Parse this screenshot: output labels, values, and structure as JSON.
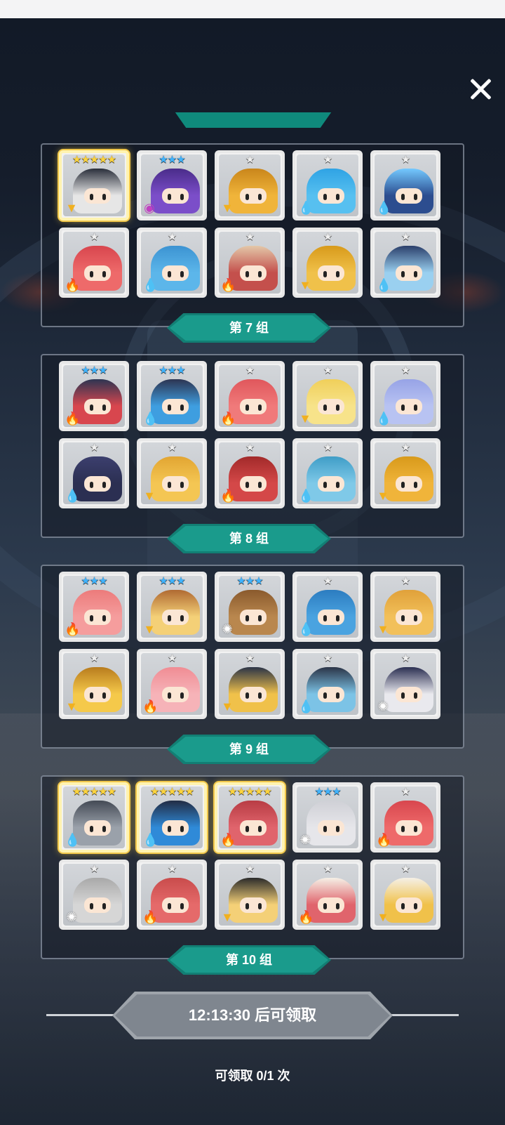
{
  "close": {
    "icon": "close-icon"
  },
  "groups": [
    {
      "label": "第 7 组",
      "heroes": [
        {
          "stars": "★★★★★",
          "rarity": "gold",
          "element": "earth",
          "color": "#e6e6e6",
          "hair": "#2a2f3b"
        },
        {
          "stars": "★★★",
          "rarity": "blue",
          "element": "dark",
          "color": "#7b4ec9",
          "hair": "#4a2c8a"
        },
        {
          "stars": "★",
          "rarity": "grey",
          "element": "earth",
          "color": "#f0b43a",
          "hair": "#c9861b"
        },
        {
          "stars": "★",
          "rarity": "grey",
          "element": "water",
          "color": "#57c0f0",
          "hair": "#2fa3e4"
        },
        {
          "stars": "★",
          "rarity": "grey",
          "element": "water",
          "color": "#2c4d8f",
          "hair": "#74c9ff"
        },
        {
          "stars": "★",
          "rarity": "grey",
          "element": "fire",
          "color": "#ee6a6a",
          "hair": "#d8464e"
        },
        {
          "stars": "★",
          "rarity": "grey",
          "element": "water",
          "color": "#5cb6ea",
          "hair": "#3c93d2"
        },
        {
          "stars": "★",
          "rarity": "grey",
          "element": "fire",
          "color": "#c4504c",
          "hair": "#e3c7a8"
        },
        {
          "stars": "★",
          "rarity": "grey",
          "element": "earth",
          "color": "#f0c14a",
          "hair": "#d89a1b"
        },
        {
          "stars": "★",
          "rarity": "grey",
          "element": "water",
          "color": "#9ad0f0",
          "hair": "#2b3f6b"
        }
      ]
    },
    {
      "label": "第 8 组",
      "heroes": [
        {
          "stars": "★★★",
          "rarity": "blue",
          "element": "fire",
          "color": "#d8464e",
          "hair": "#2d3552"
        },
        {
          "stars": "★★★",
          "rarity": "blue",
          "element": "water",
          "color": "#3e9ee0",
          "hair": "#2d3552"
        },
        {
          "stars": "★",
          "rarity": "grey",
          "element": "fire",
          "color": "#f07a7a",
          "hair": "#e0575c"
        },
        {
          "stars": "★",
          "rarity": "grey",
          "element": "earth",
          "color": "#f7e38a",
          "hair": "#f0cf5a"
        },
        {
          "stars": "★",
          "rarity": "grey",
          "element": "water",
          "color": "#b8c3f2",
          "hair": "#97a3e6"
        },
        {
          "stars": "★",
          "rarity": "grey",
          "element": "water",
          "color": "#2b2f52",
          "hair": "#3c3f6e"
        },
        {
          "stars": "★",
          "rarity": "grey",
          "element": "earth",
          "color": "#f4c653",
          "hair": "#e2a532"
        },
        {
          "stars": "★",
          "rarity": "grey",
          "element": "fire",
          "color": "#d44848",
          "hair": "#a22a2a"
        },
        {
          "stars": "★",
          "rarity": "grey",
          "element": "water",
          "color": "#7fc9e8",
          "hair": "#3f9dc7"
        },
        {
          "stars": "★",
          "rarity": "grey",
          "element": "earth",
          "color": "#f0b43a",
          "hair": "#d89a1b"
        }
      ]
    },
    {
      "label": "第 9 组",
      "heroes": [
        {
          "stars": "★★★",
          "rarity": "blue",
          "element": "fire",
          "color": "#f59d9d",
          "hair": "#ec7b7b"
        },
        {
          "stars": "★★★",
          "rarity": "blue",
          "element": "earth",
          "color": "#f4d077",
          "hair": "#b06a32"
        },
        {
          "stars": "★★★",
          "rarity": "blue",
          "element": "light",
          "color": "#b9874e",
          "hair": "#8a5a2d"
        },
        {
          "stars": "★",
          "rarity": "grey",
          "element": "water",
          "color": "#4aa3e0",
          "hair": "#2c7cc0"
        },
        {
          "stars": "★",
          "rarity": "grey",
          "element": "earth",
          "color": "#f2c05a",
          "hair": "#e0a13a"
        },
        {
          "stars": "★",
          "rarity": "grey",
          "element": "earth",
          "color": "#f5c94a",
          "hair": "#b87c1e"
        },
        {
          "stars": "★",
          "rarity": "grey",
          "element": "fire",
          "color": "#f6b3b8",
          "hair": "#f08c94"
        },
        {
          "stars": "★",
          "rarity": "grey",
          "element": "earth",
          "color": "#f0c14a",
          "hair": "#2b3447"
        },
        {
          "stars": "★",
          "rarity": "grey",
          "element": "water",
          "color": "#7cc3e6",
          "hair": "#2b3447"
        },
        {
          "stars": "★",
          "rarity": "grey",
          "element": "light",
          "color": "#e9e9ee",
          "hair": "#2b2f52"
        }
      ]
    },
    {
      "label": "第 10 组",
      "heroes": [
        {
          "stars": "★★★★★",
          "rarity": "gold",
          "element": "water",
          "color": "#9aa1aa",
          "hair": "#444a55"
        },
        {
          "stars": "★★★★★",
          "rarity": "gold",
          "element": "water",
          "color": "#2f8ad8",
          "hair": "#222c44"
        },
        {
          "stars": "★★★★★",
          "rarity": "gold",
          "element": "fire",
          "color": "#e0646c",
          "hair": "#b83c44"
        },
        {
          "stars": "★★★",
          "rarity": "blue",
          "element": "light",
          "color": "#e6e6ea",
          "hair": "#cfd0d6"
        },
        {
          "stars": "★",
          "rarity": "grey",
          "element": "fire",
          "color": "#ee6a6a",
          "hair": "#d8464e"
        },
        {
          "stars": "★",
          "rarity": "grey",
          "element": "light",
          "color": "#d6d6d6",
          "hair": "#a9a9a9"
        },
        {
          "stars": "★",
          "rarity": "grey",
          "element": "fire",
          "color": "#e56a6a",
          "hair": "#c94c4c"
        },
        {
          "stars": "★",
          "rarity": "grey",
          "element": "earth",
          "color": "#f4d077",
          "hair": "#2b2b2b"
        },
        {
          "stars": "★",
          "rarity": "grey",
          "element": "fire",
          "color": "#e0646c",
          "hair": "#f5f0e6"
        },
        {
          "stars": "★",
          "rarity": "grey",
          "element": "earth",
          "color": "#f0c14a",
          "hair": "#f5f0e6"
        }
      ]
    }
  ],
  "claim_button": {
    "label": "12:13:30 后可领取"
  },
  "claim_count": "可领取 0/1 次",
  "colors": {
    "ribbon": "#1a9b8c",
    "claim": "#7f868f"
  }
}
